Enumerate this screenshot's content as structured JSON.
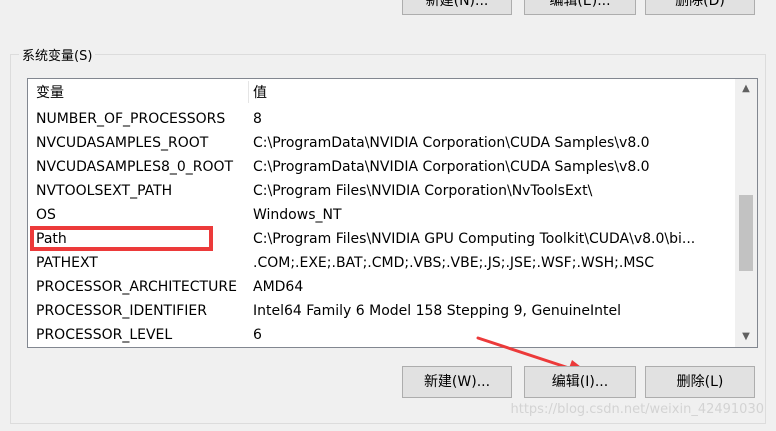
{
  "user_vars_buttons": {
    "new": "新建(N)...",
    "edit": "编辑(E)...",
    "delete": "删除(D)"
  },
  "system_variables": {
    "title": "系统变量(S)",
    "columns": {
      "name": "变量",
      "value": "值"
    },
    "rows": [
      {
        "name": "NUMBER_OF_PROCESSORS",
        "value": "8"
      },
      {
        "name": "NVCUDASAMPLES_ROOT",
        "value": "C:\\ProgramData\\NVIDIA Corporation\\CUDA Samples\\v8.0"
      },
      {
        "name": "NVCUDASAMPLES8_0_ROOT",
        "value": "C:\\ProgramData\\NVIDIA Corporation\\CUDA Samples\\v8.0"
      },
      {
        "name": "NVTOOLSEXT_PATH",
        "value": "C:\\Program Files\\NVIDIA Corporation\\NvToolsExt\\"
      },
      {
        "name": "OS",
        "value": "Windows_NT"
      },
      {
        "name": "Path",
        "value": "C:\\Program Files\\NVIDIA GPU Computing Toolkit\\CUDA\\v8.0\\bi..."
      },
      {
        "name": "PATHEXT",
        "value": ".COM;.EXE;.BAT;.CMD;.VBS;.VBE;.JS;.JSE;.WSF;.WSH;.MSC"
      },
      {
        "name": "PROCESSOR_ARCHITECTURE",
        "value": "AMD64"
      },
      {
        "name": "PROCESSOR_IDENTIFIER",
        "value": "Intel64 Family 6 Model 158 Stepping 9, GenuineIntel"
      },
      {
        "name": "PROCESSOR_LEVEL",
        "value": "6"
      }
    ]
  },
  "buttons": {
    "new": "新建(W)...",
    "edit": "编辑(I)...",
    "delete": "删除(L)"
  },
  "scrollbar": {
    "up_icon": "chevron-up-icon",
    "down_icon": "chevron-down-icon"
  },
  "watermark": "https://blog.csdn.net/weixin_42491030",
  "colors": {
    "annotation": "#ec3a3a",
    "window_bg": "#f0f0f0",
    "button_bg": "#e1e1e1"
  }
}
